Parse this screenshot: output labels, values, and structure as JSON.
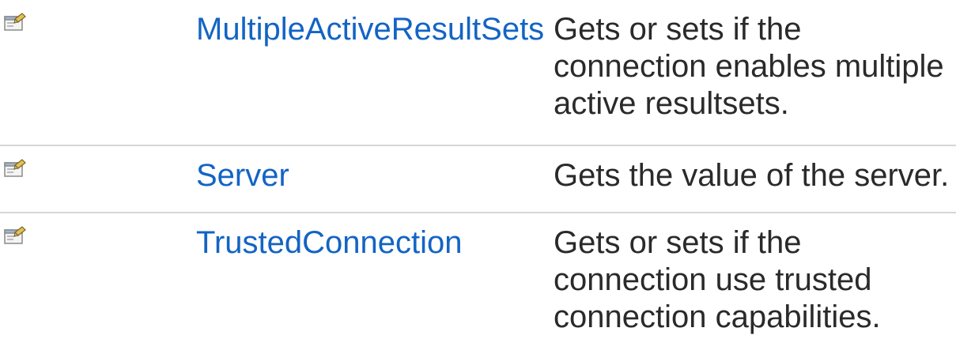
{
  "members": [
    {
      "icon": "public-property-icon",
      "name": "MultipleActiveResultSets",
      "description": "Gets or sets if the connection enables multiple active resultsets."
    },
    {
      "icon": "public-property-icon",
      "name": "Server",
      "description": "Gets the value of the server."
    },
    {
      "icon": "public-property-icon",
      "name": "TrustedConnection",
      "description": "Gets or sets if the connection use trusted connection capabilities."
    }
  ]
}
